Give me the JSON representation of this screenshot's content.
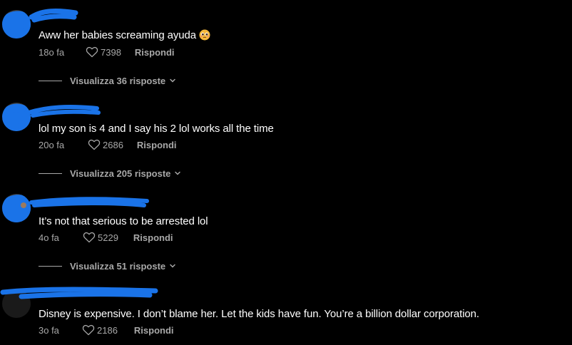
{
  "colors": {
    "background": "#000000",
    "text": "#ffffff",
    "muted": "#a8a8a8",
    "scribble": "#1a73e8"
  },
  "comments": [
    {
      "username": "",
      "text": "Aww her babies screaming ayuda",
      "emoji": "pleading-face-emoji",
      "age": "18o fa",
      "likes": "7398",
      "reply_label": "Rispondi",
      "view_replies": "Visualizza 36 risposte"
    },
    {
      "username": "",
      "text": "lol my son is 4 and I say his 2 lol works all the time",
      "age": "20o fa",
      "likes": "2686",
      "reply_label": "Rispondi",
      "view_replies": "Visualizza 205 risposte"
    },
    {
      "username": "",
      "text": "It’s not that serious to be arrested lol",
      "age": "4o fa",
      "likes": "5229",
      "reply_label": "Rispondi",
      "view_replies": "Visualizza 51 risposte"
    },
    {
      "username": "",
      "text": "Disney is expensive. I don’t blame her. Let the kids have fun. You’re a billion dollar corporation.",
      "age": "3o fa",
      "likes": "2186",
      "reply_label": "Rispondi"
    }
  ],
  "icons": {
    "like": "heart-outline-icon",
    "expand": "chevron-down-icon"
  }
}
